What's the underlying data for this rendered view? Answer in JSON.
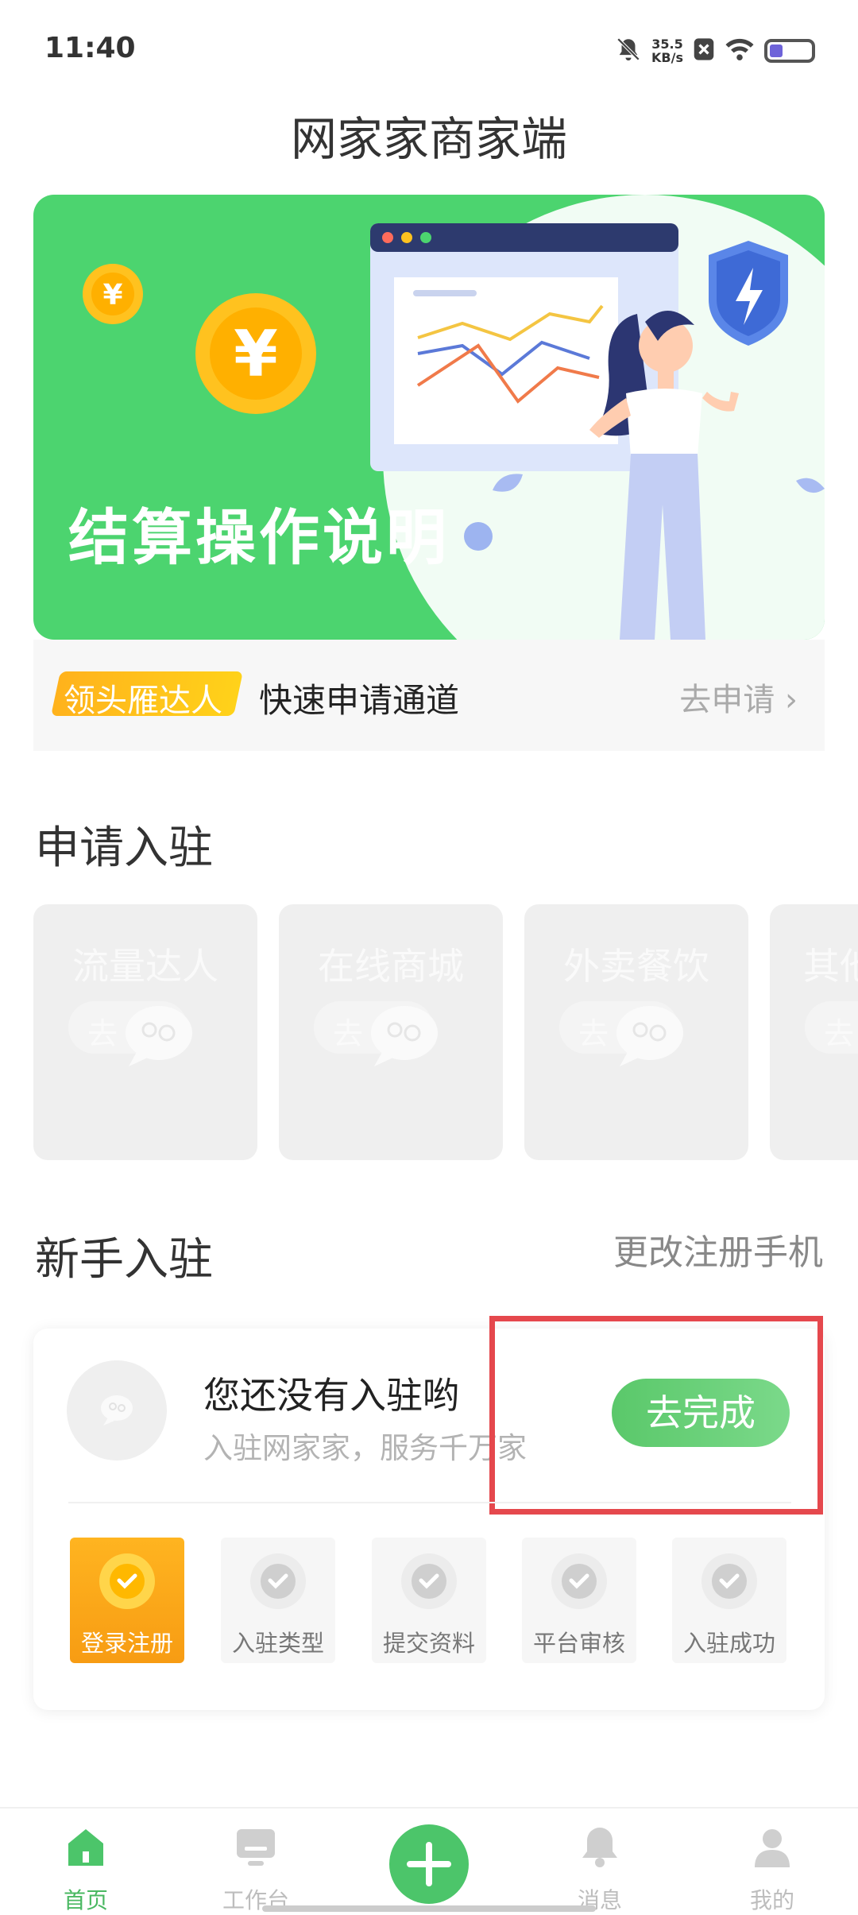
{
  "status_bar": {
    "time": "11:40",
    "speed_value": "35.5",
    "speed_unit": "KB/s"
  },
  "header": {
    "title": "网家家商家端"
  },
  "banner": {
    "text": "结算操作说明"
  },
  "quick_apply": {
    "tag": "领头雁达人",
    "title": "快速申请通道",
    "link": "去申请 ›"
  },
  "apply_section": {
    "title": "申请入驻",
    "cards": [
      {
        "label": "流量达人",
        "button": "去"
      },
      {
        "label": "在线商城",
        "button": "去"
      },
      {
        "label": "外卖餐饮",
        "button": "去"
      },
      {
        "label": "其他",
        "button": "去"
      }
    ]
  },
  "newbie_section": {
    "title": "新手入驻",
    "change_phone": "更改注册手机",
    "status_title": "您还没有入驻哟",
    "status_subtitle": "入驻网家家，服务千万家",
    "finish_button": "去完成",
    "steps": [
      {
        "label": "登录注册",
        "active": true
      },
      {
        "label": "入驻类型",
        "active": false
      },
      {
        "label": "提交资料",
        "active": false
      },
      {
        "label": "平台审核",
        "active": false
      },
      {
        "label": "入驻成功",
        "active": false
      }
    ]
  },
  "tab_bar": {
    "tabs": [
      {
        "label": "首页",
        "icon": "home-icon",
        "active": true
      },
      {
        "label": "工作台",
        "icon": "workbench-icon",
        "active": false
      },
      {
        "label": "",
        "icon": "plus-icon",
        "active": false
      },
      {
        "label": "消息",
        "icon": "bell-icon",
        "active": false
      },
      {
        "label": "我的",
        "icon": "user-icon",
        "active": false
      }
    ]
  },
  "colors": {
    "brand_green": "#4cd46f",
    "button_green": "#5ac86a",
    "highlight_red": "#e5484d",
    "tag_orange": "#ffb21c"
  }
}
